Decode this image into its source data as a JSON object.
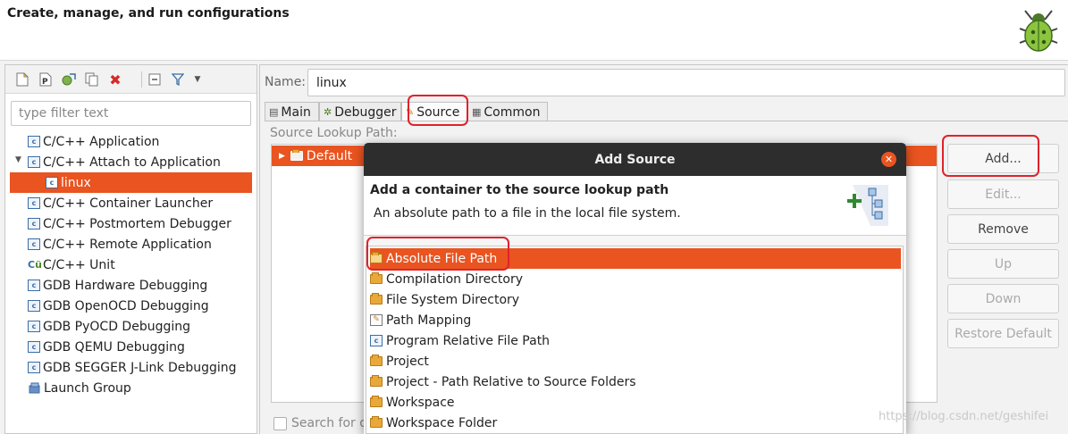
{
  "header": {
    "title": "Create, manage, and run configurations"
  },
  "left": {
    "filter_placeholder": "type filter text",
    "tree": [
      {
        "label": "C/C++ Application"
      },
      {
        "label": "C/C++ Attach to Application"
      },
      {
        "label": "linux",
        "selected": true
      },
      {
        "label": "C/C++ Container Launcher"
      },
      {
        "label": "C/C++ Postmortem Debugger"
      },
      {
        "label": "C/C++ Remote Application"
      },
      {
        "label": "C/C++ Unit"
      },
      {
        "label": "GDB Hardware Debugging"
      },
      {
        "label": "GDB OpenOCD Debugging"
      },
      {
        "label": "GDB PyOCD Debugging"
      },
      {
        "label": "GDB QEMU Debugging"
      },
      {
        "label": "GDB SEGGER J-Link Debugging"
      },
      {
        "label": "Launch Group"
      }
    ]
  },
  "editor": {
    "name_label": "Name:",
    "name_value": "linux",
    "tabs": [
      {
        "label": "Main"
      },
      {
        "label": "Debugger"
      },
      {
        "label": "Source",
        "active": true
      },
      {
        "label": "Common"
      }
    ],
    "lookup_label": "Source Lookup Path:",
    "lookup_items": [
      {
        "label": "Default"
      }
    ],
    "buttons": {
      "add": "Add...",
      "edit": "Edit...",
      "remove": "Remove",
      "up": "Up",
      "down": "Down",
      "restore": "Restore Default"
    },
    "search_label": "Search for d"
  },
  "dialog": {
    "title": "Add Source",
    "header_title": "Add a container to the source lookup path",
    "header_desc": "An absolute path to a file in the local file system.",
    "items": [
      {
        "label": "Absolute File Path",
        "selected": true
      },
      {
        "label": "Compilation Directory"
      },
      {
        "label": "File System Directory"
      },
      {
        "label": "Path Mapping"
      },
      {
        "label": "Program Relative File Path"
      },
      {
        "label": "Project"
      },
      {
        "label": "Project - Path Relative to Source Folders"
      },
      {
        "label": "Workspace"
      },
      {
        "label": "Workspace Folder"
      }
    ]
  },
  "watermark": "https://blog.csdn.net/geshifei",
  "colors": {
    "selection": "#e95420",
    "annotation": "#e0222b",
    "titlebar": "#2d2d2d"
  }
}
